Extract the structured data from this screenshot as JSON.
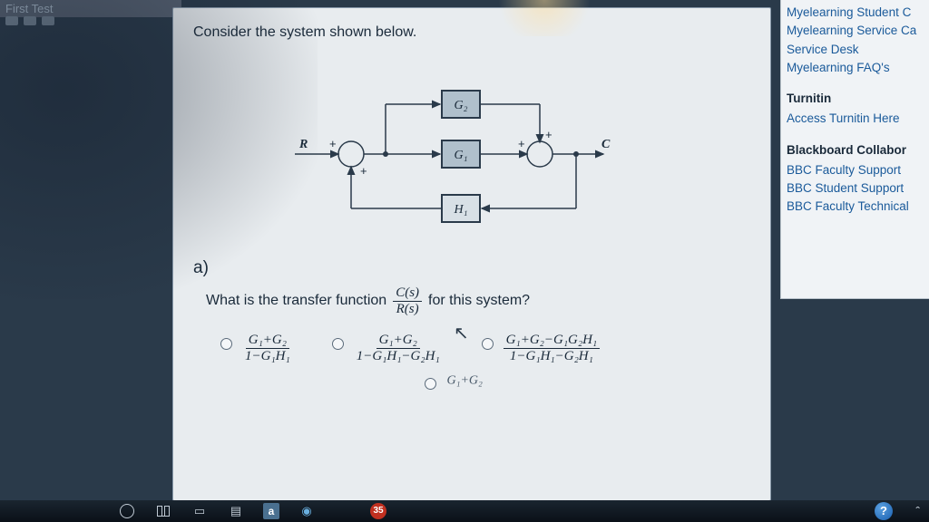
{
  "window": {
    "title": "First Test"
  },
  "question": {
    "instruction": "Consider the system shown below.",
    "part": "a)",
    "prompt_before": "What is the transfer function",
    "tf_num": "C(s)",
    "tf_den": "R(s)",
    "prompt_after": "for this system?"
  },
  "diagram": {
    "input": "R",
    "output": "C",
    "block_top": "G₂",
    "block_mid": "G₁",
    "block_bottom": "H₁",
    "sum1_inputs": [
      "+",
      "+"
    ],
    "sum2_inputs": [
      "+"
    ]
  },
  "options": [
    {
      "num": "G₁+G₂",
      "den": "1−G₁H₁"
    },
    {
      "num": "G₁+G₂",
      "den": "1−G₁H₁−G₂H₁"
    },
    {
      "num": "G₁+G₂−G₁G₂H₁",
      "den": "1−G₁H₁−G₂H₁"
    }
  ],
  "partial_option": "G₁+G₂",
  "sidebar": {
    "links_top": [
      "Myelearning Student C",
      "Myelearning Service Ca",
      "Service Desk",
      "Myelearning FAQ's"
    ],
    "heading1": "Turnitin",
    "links_mid": [
      "Access Turnitin Here"
    ],
    "heading2": "Blackboard Collabor",
    "links_bot": [
      "BBC Faculty Support",
      "BBC Student Support",
      "BBC Faculty Technical"
    ]
  },
  "taskbar": {
    "letter": "a",
    "badge": "35",
    "help": "?"
  }
}
